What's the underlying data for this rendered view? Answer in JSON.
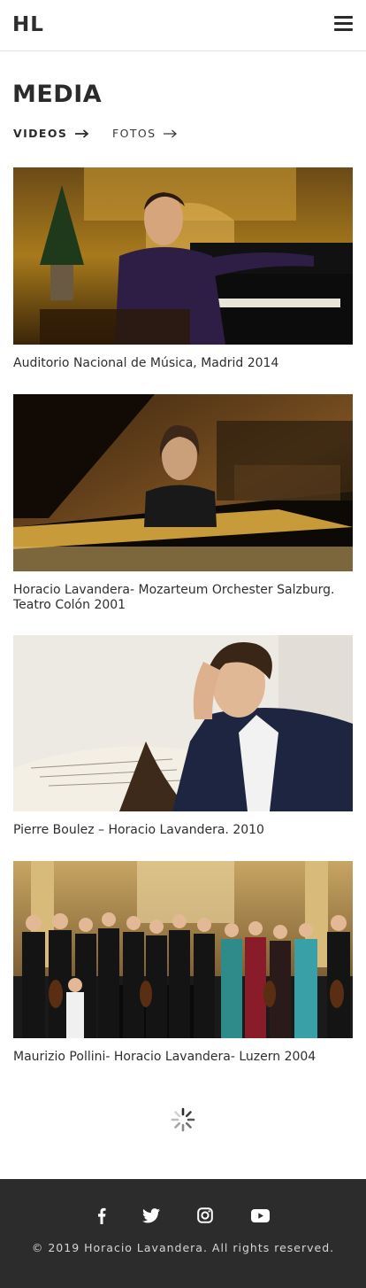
{
  "header": {
    "logo": "HL",
    "menu_icon": "hamburger-menu-icon"
  },
  "page": {
    "title": "MEDIA"
  },
  "tabs": [
    {
      "label": "VIDEOS",
      "icon": "arrow-right-icon"
    },
    {
      "label": "FOTOS",
      "icon": "arrow-right-icon"
    }
  ],
  "media": [
    {
      "caption": "Auditorio Nacional de Música,  Madrid 2014",
      "image_subject": "pianist seated at grand piano in auditorium"
    },
    {
      "caption": "Horacio Lavandera- Mozarteum Orchester Salzburg. Teatro Colón 2001",
      "image_subject": "pianist playing grand piano"
    },
    {
      "caption": "Pierre Boulez – Horacio Lavandera. 2010",
      "image_subject": "portrait of pianist resting head on hand over score"
    },
    {
      "caption": "Maurizio Pollini- Horacio Lavandera- Luzern 2004",
      "image_subject": "pianist with chamber orchestra in golden hall"
    }
  ],
  "loading_icon": "spinner-icon",
  "footer": {
    "social": [
      "facebook-icon",
      "twitter-icon",
      "instagram-icon",
      "youtube-icon"
    ],
    "copyright": "© 2019 Horacio Lavandera. All rights reserved."
  },
  "colors": {
    "text": "#2b2b2b",
    "footer_bg": "#2c2c2c",
    "footer_text": "#d6d6d6",
    "border": "#e4e4e4"
  }
}
